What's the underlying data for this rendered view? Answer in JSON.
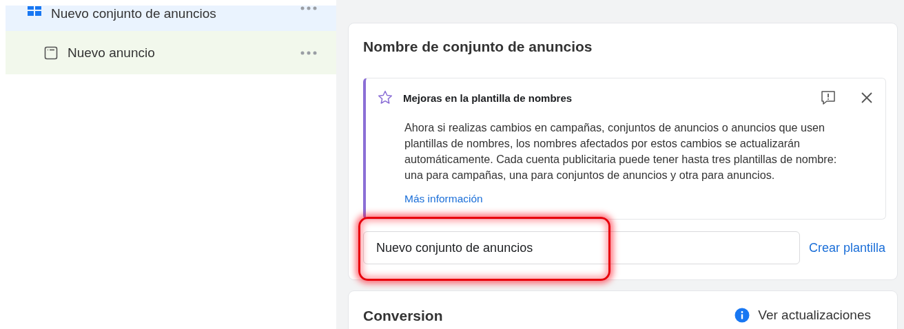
{
  "sidebar": {
    "items": [
      {
        "label": "Nuevo conjunto de anuncios",
        "kind": "adset",
        "selected": true,
        "children": [
          {
            "label": "Nuevo anuncio",
            "kind": "ad",
            "selected": false
          }
        ]
      }
    ]
  },
  "name_card": {
    "title": "Nombre de conjunto de anuncios",
    "notice": {
      "title": "Mejoras en la plantilla de nombres",
      "body": "Ahora si realizas cambios en campañas, conjuntos de anuncios o anuncios que usen plantillas de nombres, los nombres afectados por estos cambios se actualizarán automáticamente. Cada cuenta publicitaria puede tener hasta tres plantillas de nombre: una para campañas, una para conjuntos de anuncios y otra para anuncios.",
      "link": "Más información"
    },
    "name_field": {
      "value": "Nuevo conjunto de anuncios",
      "highlighted": true
    },
    "template_link": "Crear plantilla"
  },
  "conversion_card": {
    "title": "Conversion",
    "updates_link": "Ver actualizaciones"
  }
}
